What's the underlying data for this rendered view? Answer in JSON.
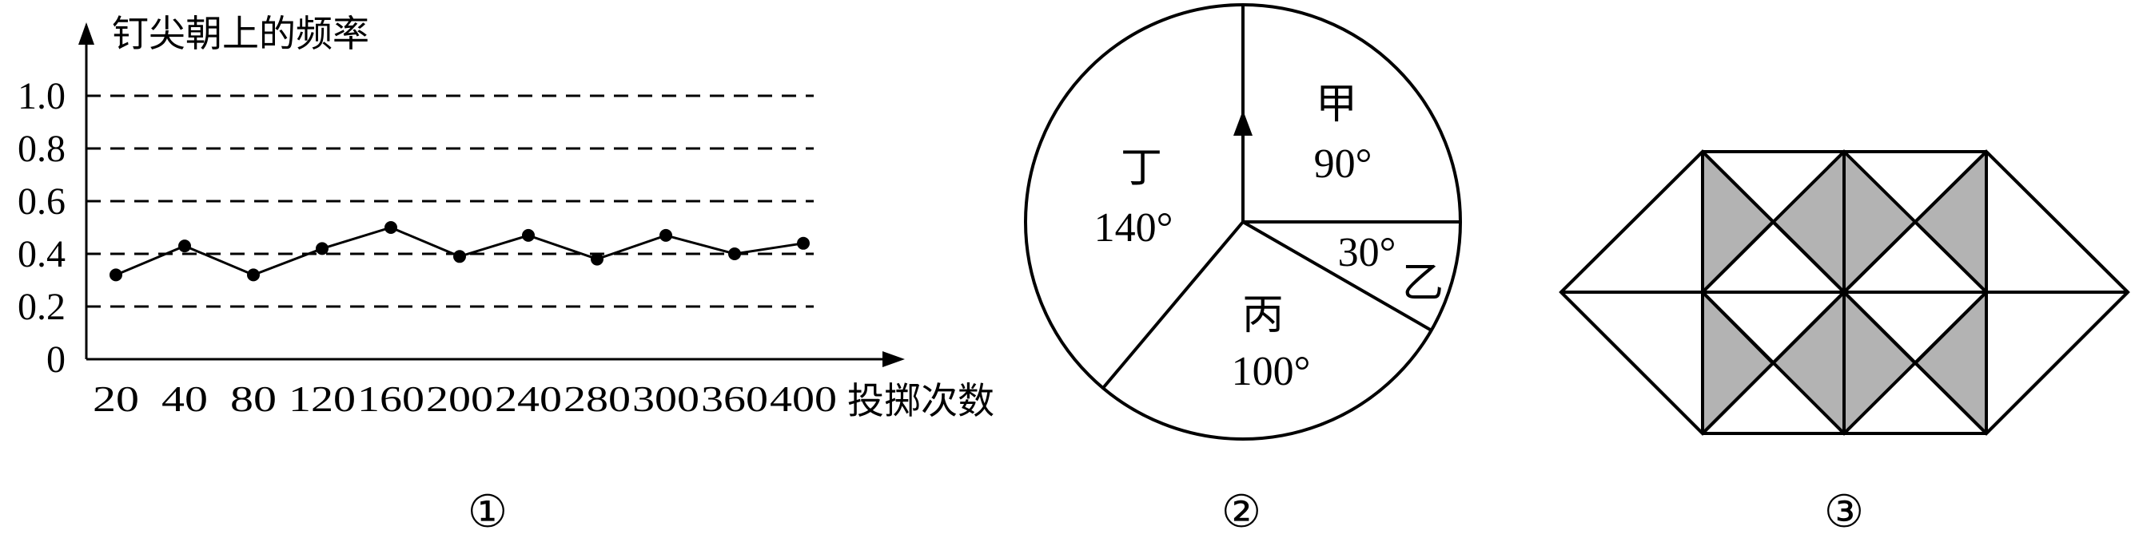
{
  "figure1": {
    "y_axis_label": "钉尖朝上的频率",
    "x_axis_label": "投掷次数",
    "y_ticks": [
      "0",
      "0.2",
      "0.4",
      "0.6",
      "0.8",
      "1.0"
    ],
    "x_ticks": [
      "20",
      "40",
      "80",
      "120",
      "160",
      "200",
      "240",
      "280",
      "300",
      "360",
      "400"
    ],
    "caption": "①"
  },
  "chart_data": {
    "type": "line",
    "x": [
      20,
      40,
      80,
      120,
      160,
      200,
      240,
      280,
      300,
      360,
      400
    ],
    "y": [
      0.32,
      0.43,
      0.32,
      0.42,
      0.5,
      0.39,
      0.47,
      0.38,
      0.47,
      0.4,
      0.44
    ],
    "xlabel": "投掷次数",
    "ylabel": "钉尖朝上的频率",
    "ylim": [
      0,
      1.0
    ],
    "grid": "dashed horizontal lines at 0.2, 0.4, 0.6, 0.8, 1.0"
  },
  "figure2": {
    "sectors": [
      {
        "name": "甲",
        "angle": "90°",
        "degrees": 90
      },
      {
        "name": "乙",
        "angle": "30°",
        "degrees": 30
      },
      {
        "name": "丙",
        "angle": "100°",
        "degrees": 100
      },
      {
        "name": "丁",
        "angle": "140°",
        "degrees": 140
      }
    ],
    "caption": "②"
  },
  "figure3": {
    "caption": "③",
    "shaded_color": "#b3b3b3"
  }
}
